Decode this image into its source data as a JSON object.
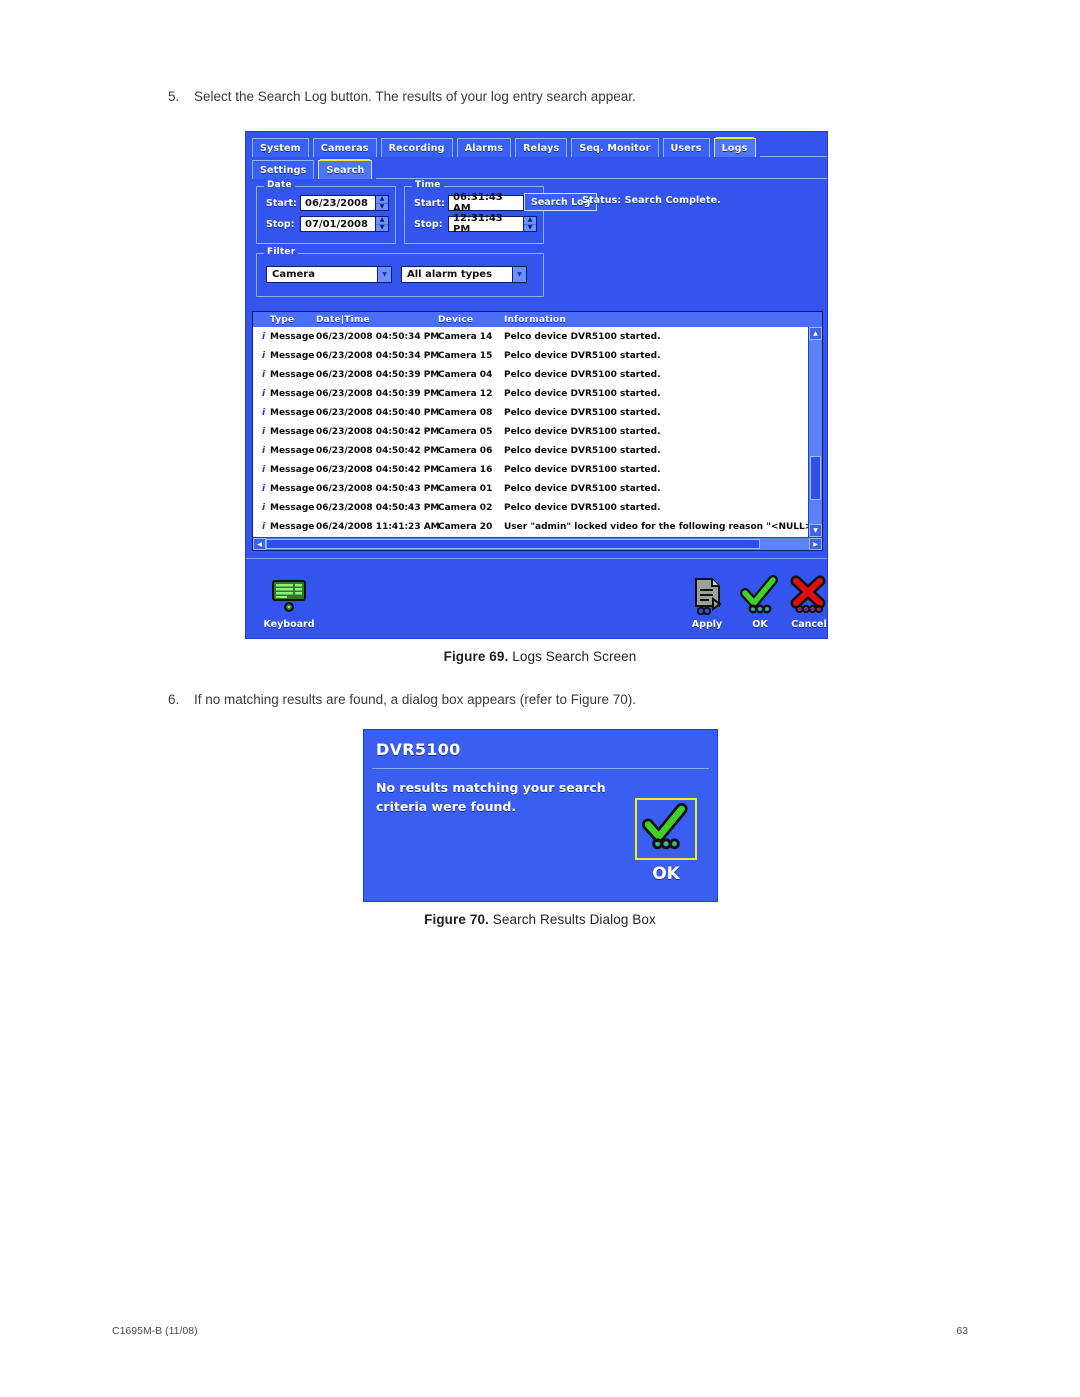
{
  "document": {
    "steps": [
      {
        "num": "5.",
        "text": "Select the Search Log button. The results of your log entry search appear."
      },
      {
        "num": "6.",
        "text": "If no matching results are found, a dialog box appears (refer to Figure 70)."
      }
    ],
    "captions": [
      {
        "label": "Figure 69.",
        "text": "Logs Search Screen"
      },
      {
        "label": "Figure 70.",
        "text": "Search Results Dialog Box"
      }
    ],
    "footer": {
      "doc_id": "C1695M-B (11/08)",
      "page": "63"
    }
  },
  "dvr": {
    "tabs_row1": [
      {
        "label": "System",
        "active": false
      },
      {
        "label": "Cameras",
        "active": false
      },
      {
        "label": "Recording",
        "active": false
      },
      {
        "label": "Alarms",
        "active": false
      },
      {
        "label": "Relays",
        "active": false
      },
      {
        "label": "Seq. Monitor",
        "active": false
      },
      {
        "label": "Users",
        "active": false
      },
      {
        "label": "Logs",
        "active": true
      }
    ],
    "tabs_row2": [
      {
        "label": "Settings",
        "active": false
      },
      {
        "label": "Search",
        "active": true
      }
    ],
    "date_group": {
      "title": "Date",
      "start_label": "Start:",
      "start_value": "06/23/2008",
      "stop_label": "Stop:",
      "stop_value": "07/01/2008"
    },
    "time_group": {
      "title": "Time",
      "start_label": "Start:",
      "start_value": "06:31:43 AM",
      "stop_label": "Stop:",
      "stop_value": "12:31:43 PM"
    },
    "search_log_button": "Search Log",
    "status": "Status: Search Complete.",
    "filter_group": {
      "title": "Filter",
      "device_value": "Camera",
      "alarm_value": "All alarm types"
    },
    "log_table": {
      "headers": {
        "type": "Type",
        "datetime": "Date|Time",
        "device": "Device",
        "information": "Information"
      },
      "rows": [
        {
          "icon": "i",
          "type": "Message",
          "datetime": "06/23/2008 04:50:34 PM",
          "device": "Camera 14",
          "information": "Pelco device DVR5100 started."
        },
        {
          "icon": "i",
          "type": "Message",
          "datetime": "06/23/2008 04:50:34 PM",
          "device": "Camera 15",
          "information": "Pelco device DVR5100 started."
        },
        {
          "icon": "i",
          "type": "Message",
          "datetime": "06/23/2008 04:50:39 PM",
          "device": "Camera 04",
          "information": "Pelco device DVR5100 started."
        },
        {
          "icon": "i",
          "type": "Message",
          "datetime": "06/23/2008 04:50:39 PM",
          "device": "Camera 12",
          "information": "Pelco device DVR5100 started."
        },
        {
          "icon": "i",
          "type": "Message",
          "datetime": "06/23/2008 04:50:40 PM",
          "device": "Camera 08",
          "information": "Pelco device DVR5100 started."
        },
        {
          "icon": "i",
          "type": "Message",
          "datetime": "06/23/2008 04:50:42 PM",
          "device": "Camera 05",
          "information": "Pelco device DVR5100 started."
        },
        {
          "icon": "i",
          "type": "Message",
          "datetime": "06/23/2008 04:50:42 PM",
          "device": "Camera 06",
          "information": "Pelco device DVR5100 started."
        },
        {
          "icon": "i",
          "type": "Message",
          "datetime": "06/23/2008 04:50:42 PM",
          "device": "Camera 16",
          "information": "Pelco device DVR5100 started."
        },
        {
          "icon": "i",
          "type": "Message",
          "datetime": "06/23/2008 04:50:43 PM",
          "device": "Camera 01",
          "information": "Pelco device DVR5100 started."
        },
        {
          "icon": "i",
          "type": "Message",
          "datetime": "06/23/2008 04:50:43 PM",
          "device": "Camera 02",
          "information": "Pelco device DVR5100 started."
        },
        {
          "icon": "i",
          "type": "Message",
          "datetime": "06/24/2008 11:41:23 AM",
          "device": "Camera 20",
          "information": "User \"admin\" locked video for the following reason \"<NULL>\"."
        }
      ]
    },
    "toolbar": {
      "keyboard": "Keyboard",
      "apply": "Apply",
      "ok": "OK",
      "cancel": "Cancel"
    }
  },
  "dialog": {
    "title": "DVR5100",
    "message": "No results matching your search criteria were found.",
    "ok_label": "OK"
  },
  "colors": {
    "dvr_blue": "#3355ee",
    "tab_border": "#93b4ff",
    "accent_yellow": "#e8ee2a",
    "icon_green": "#3fd12a",
    "icon_red": "#e01010",
    "field_white": "#ffffff"
  }
}
